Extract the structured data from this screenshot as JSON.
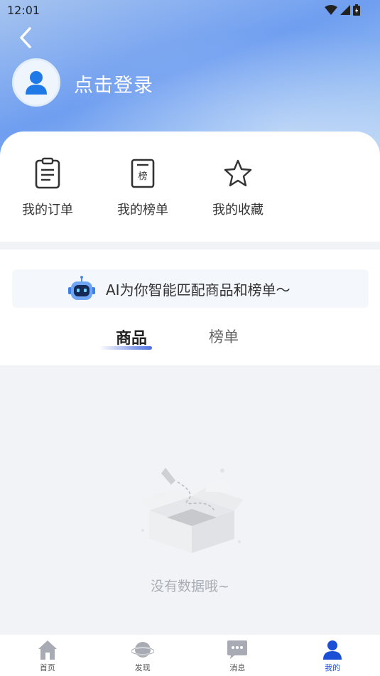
{
  "status_bar": {
    "time": "12:01"
  },
  "profile": {
    "login_text": "点击登录"
  },
  "shortcuts": [
    {
      "label": "我的订单",
      "icon": "clipboard-icon"
    },
    {
      "label": "我的榜单",
      "icon": "ranking-list-icon",
      "badge": "榜"
    },
    {
      "label": "我的收藏",
      "icon": "star-icon"
    }
  ],
  "ai_banner": {
    "text": "AI为你智能匹配商品和榜单～",
    "icon": "robot-icon"
  },
  "tabs": [
    {
      "label": "商品",
      "active": true
    },
    {
      "label": "榜单",
      "active": false
    }
  ],
  "empty_state": {
    "text": "没有数据哦~",
    "icon": "empty-box-icon"
  },
  "bottom_nav": [
    {
      "label": "首页",
      "icon": "home-icon"
    },
    {
      "label": "发现",
      "icon": "planet-icon"
    },
    {
      "label": "消息",
      "icon": "message-icon"
    },
    {
      "label": "我的",
      "icon": "person-icon",
      "active": true
    }
  ],
  "colors": {
    "accent": "#1a4fd6",
    "header_blue": "#6f9ef0",
    "muted": "#a9adb5"
  }
}
